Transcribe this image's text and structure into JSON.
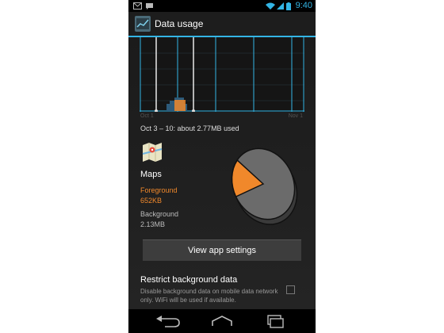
{
  "status_bar": {
    "time": "9:40",
    "icons": [
      "gmail-icon",
      "talk-icon",
      "wifi-icon",
      "signal-icon",
      "battery-icon"
    ],
    "accent_color": "#33b5e5"
  },
  "action_bar": {
    "title": "Data usage",
    "icon": "data-usage-icon"
  },
  "chart": {
    "start_label": "Oct 1",
    "end_label": "Nov 1"
  },
  "range_summary": "Oct 3 – 10: about 2.77MB used",
  "app": {
    "name": "Maps",
    "icon": "maps-icon",
    "foreground_label": "Foreground",
    "foreground_value": "652KB",
    "background_label": "Background",
    "background_value": "2.13MB",
    "foreground_color": "#f0882b",
    "background_color": "#666666"
  },
  "view_settings_label": "View app settings",
  "restrict": {
    "title": "Restrict background data",
    "description": "Disable background data on mobile data network only. WiFi will be used if available.",
    "checked": false
  },
  "nav_bar": {
    "icons": [
      "back-icon",
      "home-icon",
      "recent-apps-icon"
    ]
  }
}
